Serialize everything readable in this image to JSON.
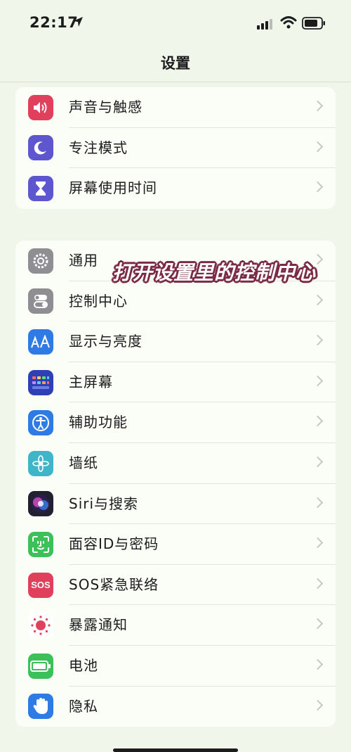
{
  "status_bar": {
    "time": "22:17"
  },
  "nav": {
    "title": "设置"
  },
  "overlay_caption": "打开设置里的控制中心",
  "group1": [
    {
      "label": "声音与触感",
      "icon": "speaker-icon",
      "color": "#e0405c"
    },
    {
      "label": "专注模式",
      "icon": "moon-icon",
      "color": "#5e56cf"
    },
    {
      "label": "屏幕使用时间",
      "icon": "hourglass-icon",
      "color": "#5e56cf"
    }
  ],
  "group2": [
    {
      "label": "通用",
      "icon": "gear-icon",
      "color": "#8e8e93"
    },
    {
      "label": "控制中心",
      "icon": "toggles-icon",
      "color": "#8e8e93"
    },
    {
      "label": "显示与亮度",
      "icon": "text-size-icon",
      "color": "#2f7be5"
    },
    {
      "label": "主屏幕",
      "icon": "grid-icon",
      "color": "#2f3fb5"
    },
    {
      "label": "辅助功能",
      "icon": "accessibility-icon",
      "color": "#2f7be5"
    },
    {
      "label": "墙纸",
      "icon": "flower-icon",
      "color": "#3fb6c8"
    },
    {
      "label": "Siri与搜索",
      "icon": "siri-icon",
      "color": "#202030"
    },
    {
      "label": "面容ID与密码",
      "icon": "faceid-icon",
      "color": "#3cc05a"
    },
    {
      "label": "SOS紧急联络",
      "icon": "sos-icon",
      "color": "#e0405c",
      "icon_text": "SOS"
    },
    {
      "label": "暴露通知",
      "icon": "exposure-icon",
      "color": "#ffffff"
    },
    {
      "label": "电池",
      "icon": "battery-icon",
      "color": "#3cc05a"
    },
    {
      "label": "隐私",
      "icon": "hand-icon",
      "color": "#2f7be5"
    }
  ]
}
